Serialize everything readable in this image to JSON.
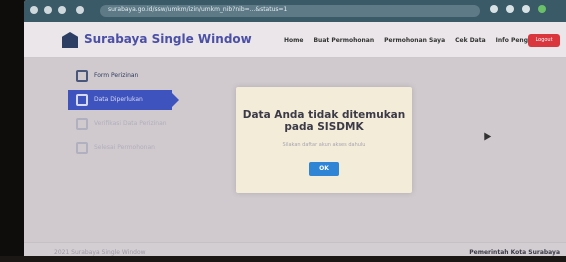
{
  "browser": {
    "url": "surabaya.go.id/ssw/umkm/izin/umkm_nib?nib=...&status=1"
  },
  "header": {
    "app_title": "Surabaya Single Window",
    "nav": [
      "Home",
      "Buat Permohonan",
      "Permohonan Saya",
      "Cek Data",
      "Info Pengaduan"
    ],
    "logout_label": "Logout"
  },
  "sidebar": {
    "items": [
      {
        "label": "Form Perizinan",
        "state": "normal"
      },
      {
        "label": "Data Diperlukan",
        "state": "active"
      },
      {
        "label": "Verifikasi Data Perizinan",
        "state": "dim"
      },
      {
        "label": "Selesai Permohonan",
        "state": "dim"
      }
    ]
  },
  "modal": {
    "title_line1": "Data Anda tidak ditemukan",
    "title_line2": "pada SISDMK",
    "message": "Silakan daftar akun akses dahulu",
    "ok_label": "OK"
  },
  "footer": {
    "left": "2021 Surabaya Single Window",
    "right": "Pemerintah Kota Surabaya"
  },
  "colors": {
    "accent": "#3e55c5",
    "ok_button": "#2f84d6",
    "logout": "#d9363e",
    "modal_bg": "#f3ecd9"
  }
}
